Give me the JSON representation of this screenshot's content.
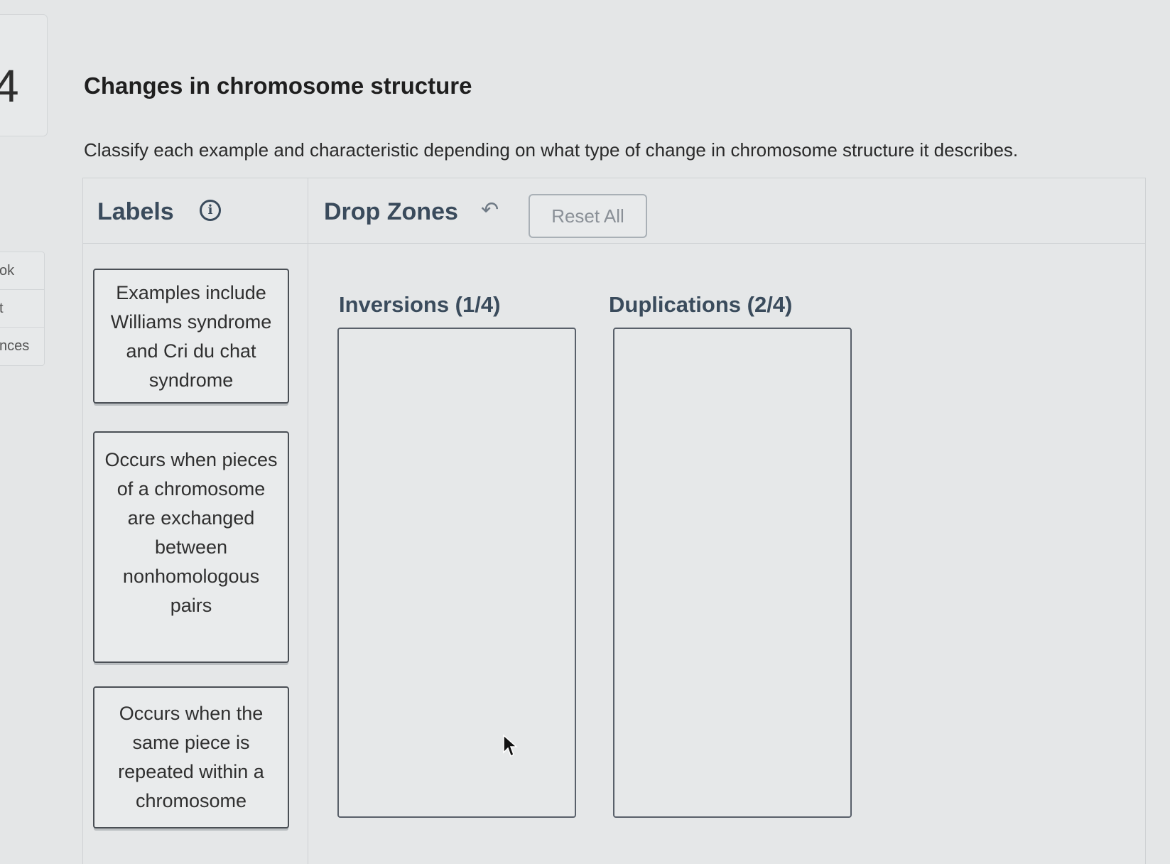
{
  "question": {
    "number": "4",
    "title": "Changes in chromosome structure",
    "instructions": "Classify each example and characteristic depending on what type of change in chromosome structure it describes."
  },
  "side_menu": {
    "items": [
      "ok",
      "t",
      "nces"
    ]
  },
  "labels_panel": {
    "title": "Labels",
    "info_icon": "info-icon",
    "cards": [
      {
        "text": "Examples include Williams syndrome and Cri du chat syndrome"
      },
      {
        "text": "Occurs when pieces of a chromosome are exchanged between nonhomologous pairs"
      },
      {
        "text": "Occurs when the same piece is repeated within a chromosome"
      }
    ]
  },
  "zones_panel": {
    "title": "Drop Zones",
    "back_icon": "back-arrow-icon",
    "reset_label": "Reset All",
    "zones": [
      {
        "label": "Inversions (1/4)"
      },
      {
        "label": "Duplications (2/4)"
      }
    ]
  },
  "colors": {
    "background": "#e4e6e7",
    "header_text": "#3a4b5c",
    "border_dark": "#4a4f55"
  }
}
